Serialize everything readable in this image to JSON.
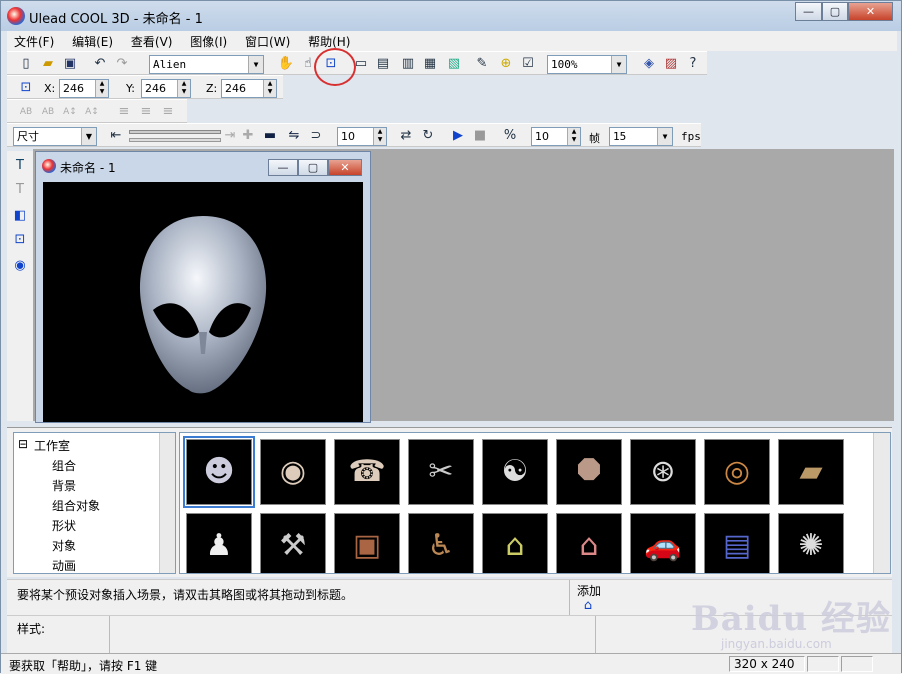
{
  "window": {
    "title": "Ulead COOL 3D - 未命名 - 1",
    "minimize": "—",
    "maximize": "▢",
    "close": "✕"
  },
  "menu": [
    "文件(F)",
    "编辑(E)",
    "查看(V)",
    "图像(I)",
    "窗口(W)",
    "帮助(H)"
  ],
  "toolbar1": {
    "font": "Alien",
    "zoom": "100%"
  },
  "position": {
    "x_label": "X:",
    "x": "246",
    "y_label": "Y:",
    "y": "246",
    "z_label": "Z:",
    "z": "246"
  },
  "animation": {
    "attribute": "尺寸",
    "frames": "10",
    "frame_count": "10",
    "frame_label": "帧",
    "fps_value": "15",
    "fps_label": "fps"
  },
  "child_window": {
    "title": "未命名 - 1"
  },
  "tree": {
    "root": "工作室",
    "items": [
      "组合",
      "背景",
      "组合对象",
      "形状",
      "对象",
      "动画"
    ]
  },
  "thumbnails": [
    "alien",
    "eye",
    "telephone",
    "scissors",
    "yin-yang",
    "octagon",
    "steering-wheel",
    "donut",
    "bread",
    "bowling-pin",
    "hammer",
    "crate",
    "chair",
    "doghouse",
    "house",
    "car",
    "floppy-disk",
    "spiderweb"
  ],
  "status": {
    "hint": "要将某个预设对象插入场景，请双击其略图或将其拖动到标题。",
    "add_label": "添加",
    "style_label": "样式:",
    "help_text": "要获取「帮助」，请按 F1 键",
    "size": "320 x 240"
  },
  "watermark": {
    "text": "Baidu 经验",
    "url": "jingyan.baidu.com"
  }
}
